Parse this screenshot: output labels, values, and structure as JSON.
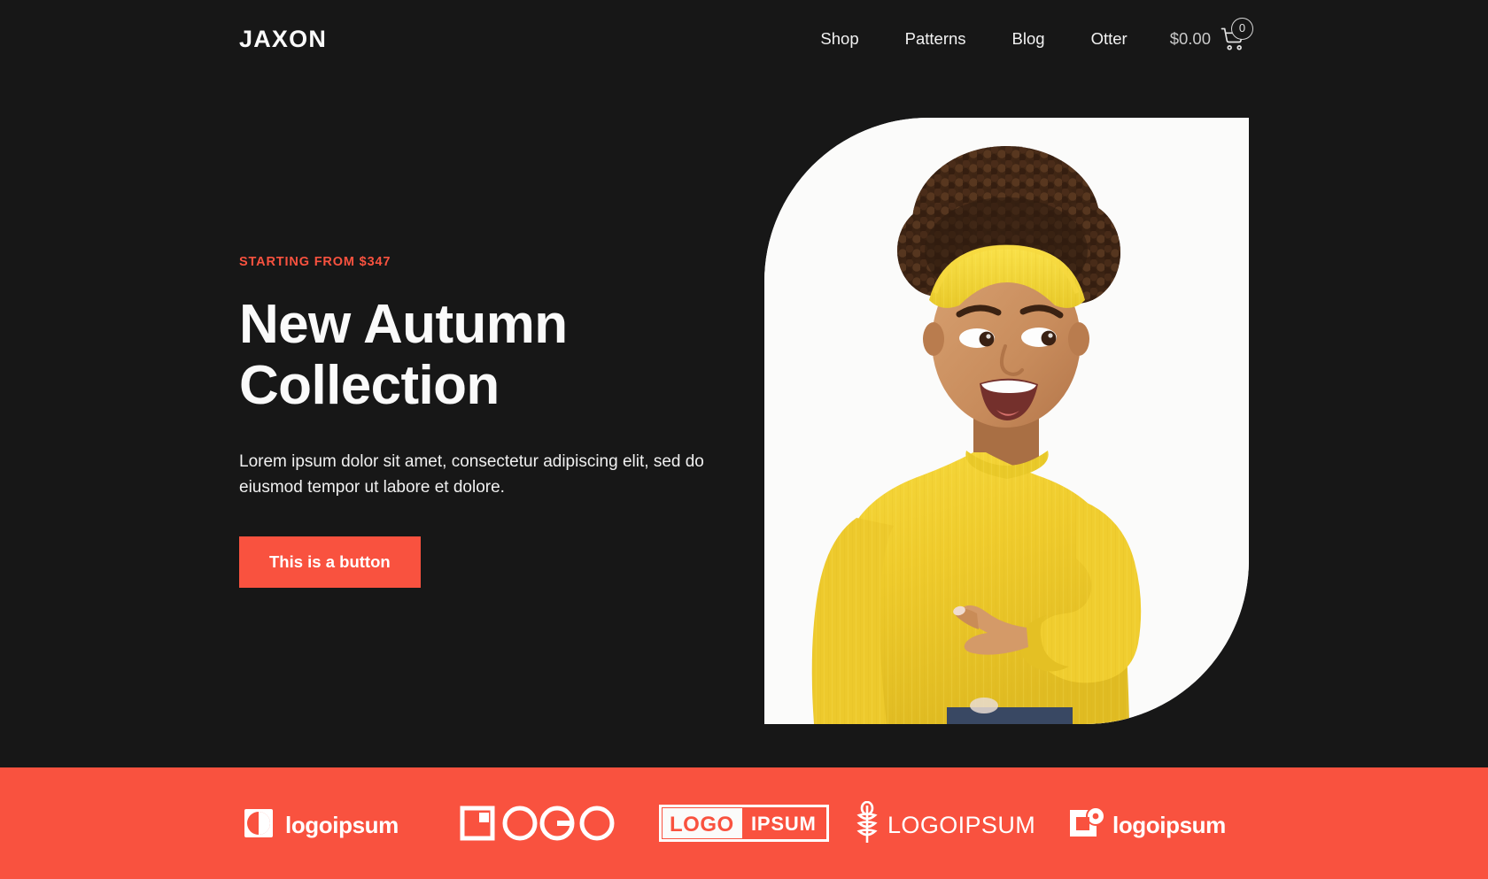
{
  "site": {
    "brand": "JAXON",
    "brand_color": "#fafafa",
    "background_color": "#171717",
    "accent_color": "#f9523f"
  },
  "header": {
    "nav_items": [
      {
        "label": "Shop"
      },
      {
        "label": "Patterns"
      },
      {
        "label": "Blog"
      },
      {
        "label": "Otter"
      }
    ],
    "cart": {
      "price": "$0.00",
      "count": "0",
      "icon": "shopping-cart-icon"
    }
  },
  "hero": {
    "eyebrow": "STARTING FROM $347",
    "title": "New Autumn Collection",
    "subtitle": "Lorem ipsum dolor sit amet, consectetur adipiscing elit, sed do eiusmod tempor ut labore et dolore.",
    "button_label": "This is a button",
    "image_alt": "Smiling woman in a yellow knit sweater and yellow headband pointing to the side"
  },
  "logobar": {
    "background_color": "#f9523f",
    "logos": [
      {
        "name": "logoipsum-half-circle",
        "text": "logoipsum"
      },
      {
        "name": "logo-geometric-letters",
        "text": "LOGO"
      },
      {
        "name": "logo-ipsum-boxed",
        "text": "LOGO IPSUM"
      },
      {
        "name": "logoipsum-wheat",
        "text": "LOGOIPSUM"
      },
      {
        "name": "logoipsum-square-dot",
        "text": "logoipsum"
      }
    ]
  }
}
